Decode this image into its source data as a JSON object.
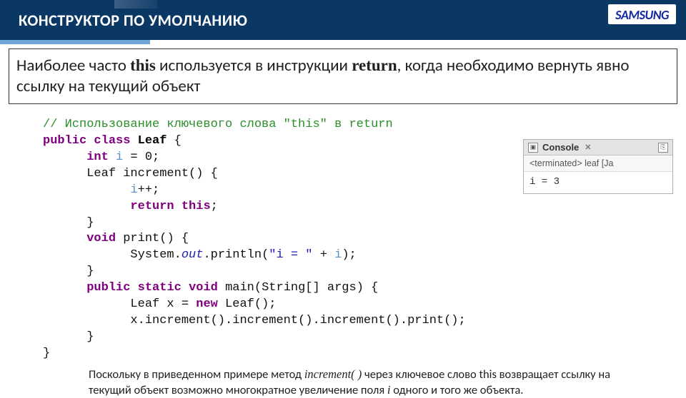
{
  "header": {
    "title": "КОНСТРУКТОР ПО УМОЛЧАНИЮ",
    "logo": "SAMSUNG"
  },
  "intro": {
    "pre": "Наиболее часто ",
    "k1": "this",
    "mid": " используется в инструкции ",
    "k2": "return",
    "post": ", когда необходимо вернуть явно ссылку на текущий объект"
  },
  "code": {
    "comment": "// Использование ключевого слова \"this\" в return",
    "l1a": "public",
    "l1b": "class",
    "l1c": "Leaf",
    "l1d": " {",
    "l2a": "int",
    "l2b": "i",
    "l2c": " = 0;",
    "l3a": "Leaf increment() {",
    "l4a": "i",
    "l4b": "++;",
    "l5a": "return",
    "l5b": "this",
    "l5c": ";",
    "l6a": "}",
    "l7a": "void",
    "l7b": " print() {",
    "l8a": "System.",
    "l8b": "out",
    "l8c": ".println(",
    "l8d": "\"i = \"",
    "l8e": " + ",
    "l8f": "i",
    "l8g": ");",
    "l9a": "}",
    "l10a": "public",
    "l10b": "static",
    "l10c": "void",
    "l10d": " main(String[] args) {",
    "l11a": "Leaf x = ",
    "l11b": "new",
    "l11c": " Leaf();",
    "l12a": "x.increment().increment().increment().print();",
    "l13a": "}",
    "l14a": "}"
  },
  "note": {
    "t1": "Поскольку в приведенном примере метод ",
    "i1": "increment( )",
    "t2": " через ключевое слово this возвращает ссылку на текущий объект возможно многократное увеличение поля ",
    "i2": "i",
    "t3": "  одного и того же объекта."
  },
  "console": {
    "tab": "Console",
    "x": "✕",
    "status": "<terminated> leaf [Ja",
    "output": "i = 3"
  }
}
